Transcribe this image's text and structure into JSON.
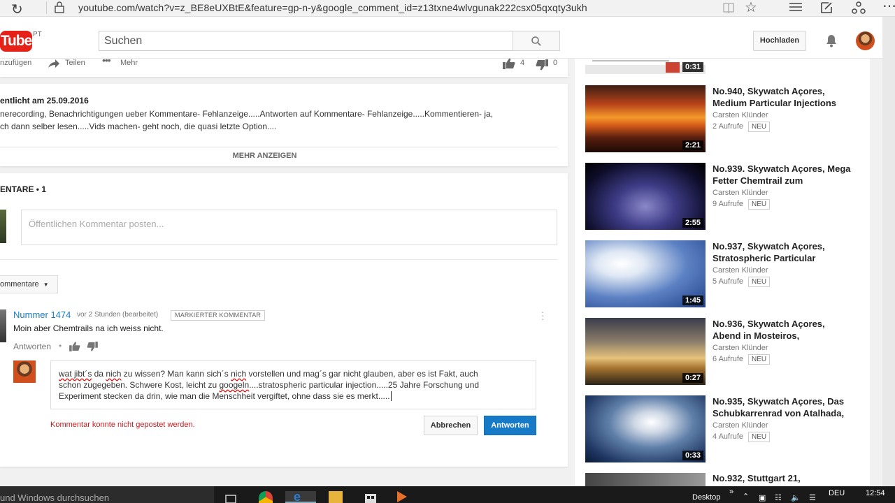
{
  "browser": {
    "url": "youtube.com/watch?v=z_BE8eUXBtE&feature=gp-n-y&google_comment_id=z13txne4wlvgunak222csx05qxqty3ukh"
  },
  "header": {
    "logo_text": "Tube",
    "logo_region": "PT",
    "search_placeholder": "Suchen",
    "upload_label": "Hochladen"
  },
  "video_actions": {
    "add_label": "nzufügen",
    "share_label": "Teilen",
    "more_label": "Mehr",
    "likes": "4",
    "dislikes": "0"
  },
  "description": {
    "published": "entlicht am 25.09.2016",
    "line1": "nerecording, Benachrichtigungen ueber Kommentare- Fehlanzeige.....Antworten auf Kommentare- Fehlanzeige.....Kommentieren- ja,",
    "line2": "ch dann selber lesen.....Vids machen- geht noch, die quasi letzte Option....",
    "show_more": "MEHR ANZEIGEN"
  },
  "comments": {
    "header": "ENTARE • 1",
    "input_placeholder": "Öffentlichen Kommentar posten...",
    "sort_label": "ommentare",
    "comment": {
      "author": "Nummer 1474",
      "meta": "vor 2 Stunden (bearbeitet)",
      "tag": "MARKIERTER KOMMENTAR",
      "text": "Moin aber Chemtrails na ich weiss nicht.",
      "reply_label": "Antworten"
    },
    "reply": {
      "line1": [
        {
          "t": "wat jibt´s",
          "err": true
        },
        {
          "t": " da ",
          "err": false
        },
        {
          "t": "nich",
          "err": true
        },
        {
          "t": " zu wissen? Man kann sich´s ",
          "err": false
        },
        {
          "t": "nich",
          "err": true
        },
        {
          "t": " vorstellen und mag´s gar nicht glauben, aber es ist Fakt, auch",
          "err": false
        }
      ],
      "line2_pre": "schon zugegeben. Schwere Kost, leicht zu ",
      "line2_err": "googeln",
      "line2_post": "....stratospheric particular injection.....25 Jahre Forschung und",
      "line3": "Experiment stecken da drin, wie man die Menschheit vergiftet, ohne dass sie es merkt.....",
      "error": "Kommentar konnte nicht gepostet werden.",
      "cancel_label": "Abbrechen",
      "submit_label": "Antworten"
    }
  },
  "sidebar": {
    "top_duration": "0:31",
    "items": [
      {
        "title": "No.940, Skywatch Açores, Medium Particular Injections",
        "channel": "Carsten Klünder",
        "views": "2 Aufrufe",
        "badge": "NEU",
        "duration": "2:21"
      },
      {
        "title": "No.939. Skywatch Açores, Mega Fetter Chemtrail zum",
        "channel": "Carsten Klünder",
        "views": "9 Aufrufe",
        "badge": "NEU",
        "duration": "2:55"
      },
      {
        "title": "No.937, Skywatch Açores, Stratospheric Particular",
        "channel": "Carsten Klünder",
        "views": "5 Aufrufe",
        "badge": "NEU",
        "duration": "1:45"
      },
      {
        "title": "No.936, Skywatch Açores, Abend in Mosteiros,",
        "channel": "Carsten Klünder",
        "views": "6 Aufrufe",
        "badge": "NEU",
        "duration": "0:27"
      },
      {
        "title": "No.935, Skywatch Açores, Das Schubkarrenrad von Atalhada,",
        "channel": "Carsten Klünder",
        "views": "4 Aufrufe",
        "badge": "NEU",
        "duration": "0:33"
      },
      {
        "title": "No.932, Stuttgart 21,"
      }
    ]
  },
  "taskbar": {
    "search_text": "und Windows durchsuchen",
    "desktop_label": "Desktop",
    "lang": "DEU",
    "time": "12:54"
  },
  "colors": {
    "brand_red": "#e62117",
    "link_blue": "#167ac6",
    "error_red": "#cc181e"
  }
}
